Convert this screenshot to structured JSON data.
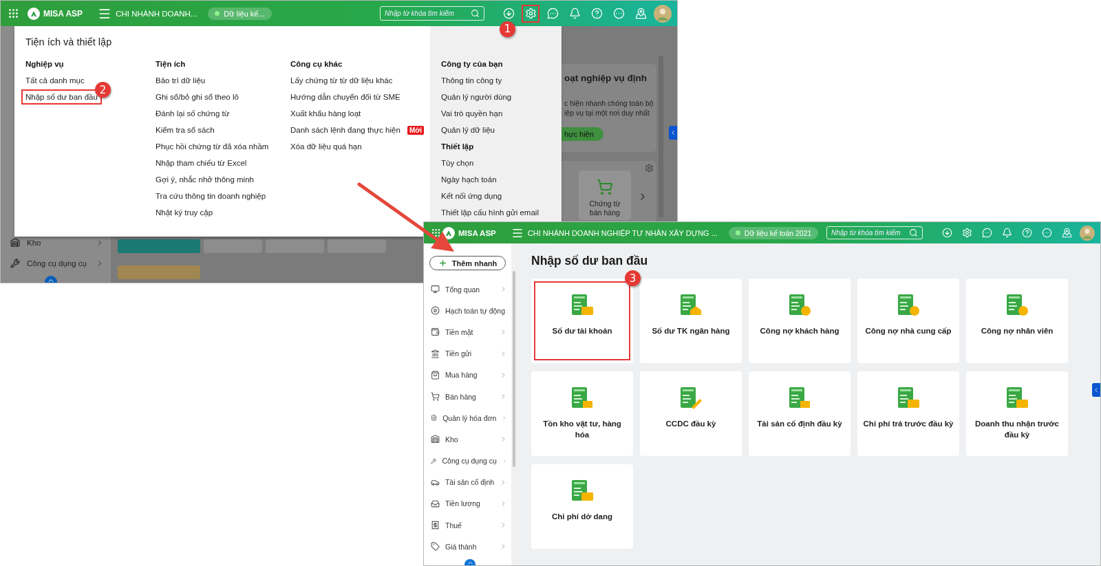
{
  "settings_screen": {
    "topbar": {
      "logo": "MISA ASP",
      "branch": "CHI NHÁNH DOANH...",
      "data_source": "Dữ liệu kế...",
      "search": {
        "placeholder": "Nhập từ khóa tìm kiếm"
      },
      "settings_highlighted": true,
      "settings_callout": "1"
    },
    "sidebar": {
      "items": [
        {
          "label": "Kho",
          "expandable": true
        },
        {
          "label": "Công cụ dụng cụ",
          "expandable": true
        }
      ]
    },
    "dashboard": {
      "promo": {
        "title": "oạt nghiệp vụ định",
        "lines": [
          "c hiện nhanh chóng toàn bộ",
          "iệp vụ tại một nơi duy nhất"
        ],
        "button": "hực hiện"
      },
      "shortcut": {
        "label": "Chứng từ bán hàng"
      }
    },
    "menu": {
      "title": "Tiện ích và thiết lập",
      "columns": [
        {
          "groups": [
            {
              "heading": "Nghiệp vụ",
              "items": [
                {
                  "label": "Tất cả danh mục",
                  "highlighted": false
                },
                {
                  "label": "Nhập số dư ban đầu",
                  "highlighted": true,
                  "callout": "2"
                }
              ]
            }
          ]
        },
        {
          "groups": [
            {
              "heading": "Tiện ích",
              "items": [
                {
                  "label": "Bảo trì dữ liệu",
                  "highlighted": false
                },
                {
                  "label": "Ghi sổ/bỏ ghi sổ theo lô",
                  "highlighted": false
                },
                {
                  "label": "Đánh lại số chứng từ",
                  "highlighted": false
                },
                {
                  "label": "Kiểm tra sổ sách",
                  "highlighted": false
                },
                {
                  "label": "Phục hồi chứng từ đã xóa nhầm",
                  "highlighted": false
                },
                {
                  "label": "Nhập tham chiếu từ Excel",
                  "highlighted": false
                },
                {
                  "label": "Gợi ý, nhắc nhở thông minh",
                  "highlighted": false
                },
                {
                  "label": "Tra cứu thông tin doanh nghiệp",
                  "highlighted": false
                },
                {
                  "label": "Nhật ký truy cập",
                  "highlighted": false
                }
              ]
            }
          ]
        },
        {
          "groups": [
            {
              "heading": "Công cụ khác",
              "items": [
                {
                  "label": "Lấy chứng từ từ dữ liệu khác",
                  "highlighted": false
                },
                {
                  "label": "Hướng dẫn chuyển đổi từ SME",
                  "highlighted": false
                },
                {
                  "label": "Xuất khẩu hàng loạt",
                  "highlighted": false
                },
                {
                  "label": "Danh sách lệnh đang thực hiện",
                  "highlighted": false,
                  "badge": "Mới"
                },
                {
                  "label": "Xóa dữ liệu quá hạn",
                  "highlighted": false
                }
              ]
            }
          ]
        },
        {
          "groups": [
            {
              "heading": "Công ty của bạn",
              "items": [
                {
                  "label": "Thông tin công ty",
                  "highlighted": false
                },
                {
                  "label": "Quản lý người dùng",
                  "highlighted": false
                },
                {
                  "label": "Vai trò quyền hạn",
                  "highlighted": false
                },
                {
                  "label": "Quản lý dữ liệu",
                  "highlighted": false
                }
              ]
            },
            {
              "heading": "Thiết lập",
              "items": [
                {
                  "label": "Tùy chọn",
                  "highlighted": false
                },
                {
                  "label": "Ngày hạch toán",
                  "highlighted": false
                },
                {
                  "label": "Kết nối ứng dụng",
                  "highlighted": false
                },
                {
                  "label": "Thiết lập cấu hình gửi email",
                  "highlighted": false
                }
              ]
            }
          ]
        }
      ]
    }
  },
  "opening_balance_screen": {
    "topbar": {
      "logo": "MISA ASP",
      "branch": "CHI NHÁNH DOANH NGHIỆP TƯ NHÂN XÂY DỰNG ...",
      "data_source": "Dữ liệu kế toán 2021",
      "search": {
        "placeholder": "Nhập từ khóa tìm kiếm"
      },
      "settings_highlighted": false
    },
    "sidebar": {
      "quick_add": "Thêm nhanh",
      "items": [
        {
          "label": "Tổng quan",
          "expandable": true
        },
        {
          "label": "Hạch toán tự động",
          "expandable": false
        },
        {
          "label": "Tiền mặt",
          "expandable": true
        },
        {
          "label": "Tiền gửi",
          "expandable": true
        },
        {
          "label": "Mua hàng",
          "expandable": true
        },
        {
          "label": "Bán hàng",
          "expandable": true
        },
        {
          "label": "Quản lý hóa đơn",
          "expandable": true
        },
        {
          "label": "Kho",
          "expandable": true
        },
        {
          "label": "Công cụ dụng cụ",
          "expandable": true
        },
        {
          "label": "Tài sản cố định",
          "expandable": true
        },
        {
          "label": "Tiền lương",
          "expandable": true
        },
        {
          "label": "Thuế",
          "expandable": true
        },
        {
          "label": "Giá thành",
          "expandable": true
        }
      ]
    },
    "title": "Nhập số dư ban đầu",
    "cards": [
      {
        "label": "Số dư tài khoản",
        "highlighted": true,
        "callout": "3"
      },
      {
        "label": "Số dư TK ngân hàng",
        "highlighted": false
      },
      {
        "label": "Công nợ khách hàng",
        "highlighted": false
      },
      {
        "label": "Công nợ nhà cung cấp",
        "highlighted": false
      },
      {
        "label": "Công nợ nhân viên",
        "highlighted": false
      },
      {
        "label": "Tồn kho vật tư, hàng hóa",
        "highlighted": false
      },
      {
        "label": "CCDC đầu kỳ",
        "highlighted": false
      },
      {
        "label": "Tài sản cố định đầu kỳ",
        "highlighted": false
      },
      {
        "label": "Chi phí trả trước đầu kỳ",
        "highlighted": false
      },
      {
        "label": "Doanh thu nhận trước đầu kỳ",
        "highlighted": false
      },
      {
        "label": "Chi phí dở dang",
        "highlighted": false
      }
    ]
  }
}
